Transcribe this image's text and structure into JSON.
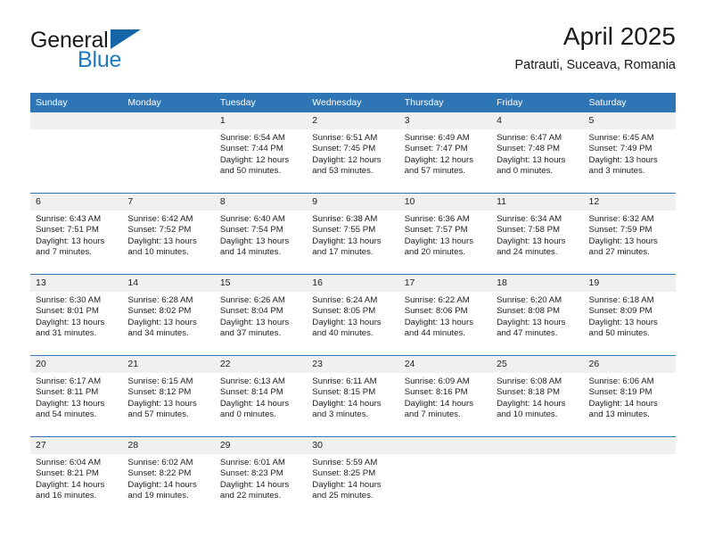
{
  "brand": {
    "name_part1": "General",
    "name_part2": "Blue"
  },
  "header": {
    "title": "April 2025",
    "subtitle": "Patrauti, Suceava, Romania"
  },
  "colors": {
    "header_blue": "#2e75b6",
    "brand_blue": "#1f7ac0",
    "daynum_bg": "#f0f0f0"
  },
  "weekday_headers": [
    "Sunday",
    "Monday",
    "Tuesday",
    "Wednesday",
    "Thursday",
    "Friday",
    "Saturday"
  ],
  "weeks": [
    [
      {
        "day": "",
        "sunrise": "",
        "sunset": "",
        "daylight_line1": "",
        "daylight_line2": ""
      },
      {
        "day": "",
        "sunrise": "",
        "sunset": "",
        "daylight_line1": "",
        "daylight_line2": ""
      },
      {
        "day": "1",
        "sunrise": "Sunrise: 6:54 AM",
        "sunset": "Sunset: 7:44 PM",
        "daylight_line1": "Daylight: 12 hours",
        "daylight_line2": "and 50 minutes."
      },
      {
        "day": "2",
        "sunrise": "Sunrise: 6:51 AM",
        "sunset": "Sunset: 7:45 PM",
        "daylight_line1": "Daylight: 12 hours",
        "daylight_line2": "and 53 minutes."
      },
      {
        "day": "3",
        "sunrise": "Sunrise: 6:49 AM",
        "sunset": "Sunset: 7:47 PM",
        "daylight_line1": "Daylight: 12 hours",
        "daylight_line2": "and 57 minutes."
      },
      {
        "day": "4",
        "sunrise": "Sunrise: 6:47 AM",
        "sunset": "Sunset: 7:48 PM",
        "daylight_line1": "Daylight: 13 hours",
        "daylight_line2": "and 0 minutes."
      },
      {
        "day": "5",
        "sunrise": "Sunrise: 6:45 AM",
        "sunset": "Sunset: 7:49 PM",
        "daylight_line1": "Daylight: 13 hours",
        "daylight_line2": "and 3 minutes."
      }
    ],
    [
      {
        "day": "6",
        "sunrise": "Sunrise: 6:43 AM",
        "sunset": "Sunset: 7:51 PM",
        "daylight_line1": "Daylight: 13 hours",
        "daylight_line2": "and 7 minutes."
      },
      {
        "day": "7",
        "sunrise": "Sunrise: 6:42 AM",
        "sunset": "Sunset: 7:52 PM",
        "daylight_line1": "Daylight: 13 hours",
        "daylight_line2": "and 10 minutes."
      },
      {
        "day": "8",
        "sunrise": "Sunrise: 6:40 AM",
        "sunset": "Sunset: 7:54 PM",
        "daylight_line1": "Daylight: 13 hours",
        "daylight_line2": "and 14 minutes."
      },
      {
        "day": "9",
        "sunrise": "Sunrise: 6:38 AM",
        "sunset": "Sunset: 7:55 PM",
        "daylight_line1": "Daylight: 13 hours",
        "daylight_line2": "and 17 minutes."
      },
      {
        "day": "10",
        "sunrise": "Sunrise: 6:36 AM",
        "sunset": "Sunset: 7:57 PM",
        "daylight_line1": "Daylight: 13 hours",
        "daylight_line2": "and 20 minutes."
      },
      {
        "day": "11",
        "sunrise": "Sunrise: 6:34 AM",
        "sunset": "Sunset: 7:58 PM",
        "daylight_line1": "Daylight: 13 hours",
        "daylight_line2": "and 24 minutes."
      },
      {
        "day": "12",
        "sunrise": "Sunrise: 6:32 AM",
        "sunset": "Sunset: 7:59 PM",
        "daylight_line1": "Daylight: 13 hours",
        "daylight_line2": "and 27 minutes."
      }
    ],
    [
      {
        "day": "13",
        "sunrise": "Sunrise: 6:30 AM",
        "sunset": "Sunset: 8:01 PM",
        "daylight_line1": "Daylight: 13 hours",
        "daylight_line2": "and 31 minutes."
      },
      {
        "day": "14",
        "sunrise": "Sunrise: 6:28 AM",
        "sunset": "Sunset: 8:02 PM",
        "daylight_line1": "Daylight: 13 hours",
        "daylight_line2": "and 34 minutes."
      },
      {
        "day": "15",
        "sunrise": "Sunrise: 6:26 AM",
        "sunset": "Sunset: 8:04 PM",
        "daylight_line1": "Daylight: 13 hours",
        "daylight_line2": "and 37 minutes."
      },
      {
        "day": "16",
        "sunrise": "Sunrise: 6:24 AM",
        "sunset": "Sunset: 8:05 PM",
        "daylight_line1": "Daylight: 13 hours",
        "daylight_line2": "and 40 minutes."
      },
      {
        "day": "17",
        "sunrise": "Sunrise: 6:22 AM",
        "sunset": "Sunset: 8:06 PM",
        "daylight_line1": "Daylight: 13 hours",
        "daylight_line2": "and 44 minutes."
      },
      {
        "day": "18",
        "sunrise": "Sunrise: 6:20 AM",
        "sunset": "Sunset: 8:08 PM",
        "daylight_line1": "Daylight: 13 hours",
        "daylight_line2": "and 47 minutes."
      },
      {
        "day": "19",
        "sunrise": "Sunrise: 6:18 AM",
        "sunset": "Sunset: 8:09 PM",
        "daylight_line1": "Daylight: 13 hours",
        "daylight_line2": "and 50 minutes."
      }
    ],
    [
      {
        "day": "20",
        "sunrise": "Sunrise: 6:17 AM",
        "sunset": "Sunset: 8:11 PM",
        "daylight_line1": "Daylight: 13 hours",
        "daylight_line2": "and 54 minutes."
      },
      {
        "day": "21",
        "sunrise": "Sunrise: 6:15 AM",
        "sunset": "Sunset: 8:12 PM",
        "daylight_line1": "Daylight: 13 hours",
        "daylight_line2": "and 57 minutes."
      },
      {
        "day": "22",
        "sunrise": "Sunrise: 6:13 AM",
        "sunset": "Sunset: 8:14 PM",
        "daylight_line1": "Daylight: 14 hours",
        "daylight_line2": "and 0 minutes."
      },
      {
        "day": "23",
        "sunrise": "Sunrise: 6:11 AM",
        "sunset": "Sunset: 8:15 PM",
        "daylight_line1": "Daylight: 14 hours",
        "daylight_line2": "and 3 minutes."
      },
      {
        "day": "24",
        "sunrise": "Sunrise: 6:09 AM",
        "sunset": "Sunset: 8:16 PM",
        "daylight_line1": "Daylight: 14 hours",
        "daylight_line2": "and 7 minutes."
      },
      {
        "day": "25",
        "sunrise": "Sunrise: 6:08 AM",
        "sunset": "Sunset: 8:18 PM",
        "daylight_line1": "Daylight: 14 hours",
        "daylight_line2": "and 10 minutes."
      },
      {
        "day": "26",
        "sunrise": "Sunrise: 6:06 AM",
        "sunset": "Sunset: 8:19 PM",
        "daylight_line1": "Daylight: 14 hours",
        "daylight_line2": "and 13 minutes."
      }
    ],
    [
      {
        "day": "27",
        "sunrise": "Sunrise: 6:04 AM",
        "sunset": "Sunset: 8:21 PM",
        "daylight_line1": "Daylight: 14 hours",
        "daylight_line2": "and 16 minutes."
      },
      {
        "day": "28",
        "sunrise": "Sunrise: 6:02 AM",
        "sunset": "Sunset: 8:22 PM",
        "daylight_line1": "Daylight: 14 hours",
        "daylight_line2": "and 19 minutes."
      },
      {
        "day": "29",
        "sunrise": "Sunrise: 6:01 AM",
        "sunset": "Sunset: 8:23 PM",
        "daylight_line1": "Daylight: 14 hours",
        "daylight_line2": "and 22 minutes."
      },
      {
        "day": "30",
        "sunrise": "Sunrise: 5:59 AM",
        "sunset": "Sunset: 8:25 PM",
        "daylight_line1": "Daylight: 14 hours",
        "daylight_line2": "and 25 minutes."
      },
      {
        "day": "",
        "sunrise": "",
        "sunset": "",
        "daylight_line1": "",
        "daylight_line2": ""
      },
      {
        "day": "",
        "sunrise": "",
        "sunset": "",
        "daylight_line1": "",
        "daylight_line2": ""
      },
      {
        "day": "",
        "sunrise": "",
        "sunset": "",
        "daylight_line1": "",
        "daylight_line2": ""
      }
    ]
  ]
}
